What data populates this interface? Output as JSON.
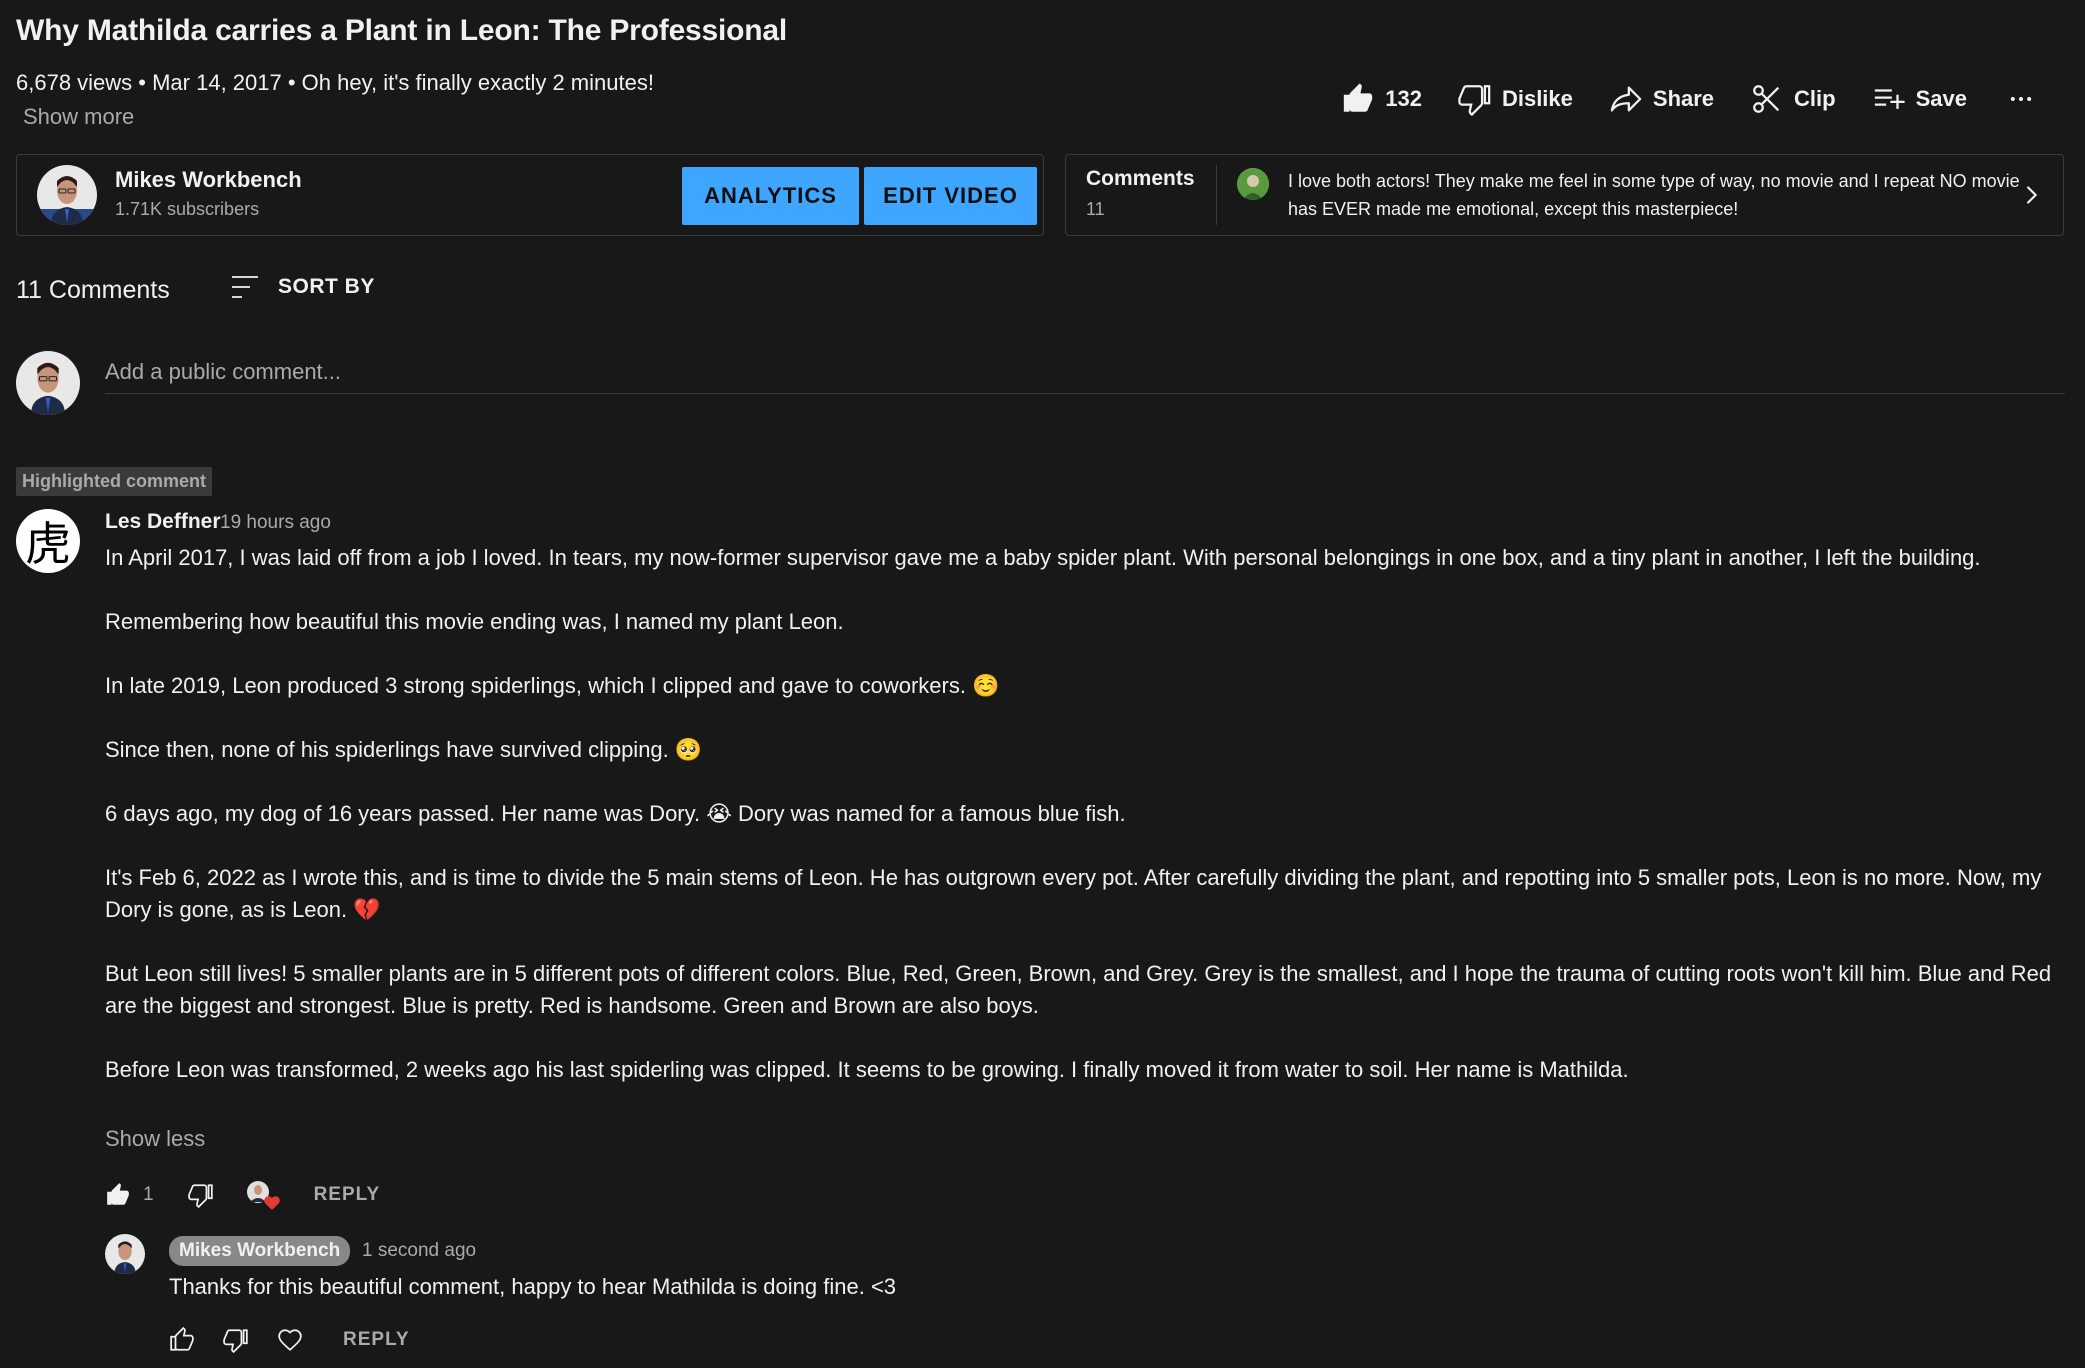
{
  "video": {
    "title": "Why Mathilda carries a Plant in Leon: The Professional",
    "meta": "6,678 views • Mar 14, 2017 • Oh hey, it's finally exactly 2 minutes!",
    "show_more": "Show more"
  },
  "actions": {
    "like_count": "132",
    "dislike": "Dislike",
    "share": "Share",
    "clip": "Clip",
    "save": "Save",
    "more_icon": "more-horiz-icon"
  },
  "channel": {
    "name": "Mikes Workbench",
    "subscribers": "1.71K subscribers",
    "analytics_button": "ANALYTICS",
    "edit_button": "EDIT VIDEO"
  },
  "comments_teaser": {
    "title": "Comments",
    "count": "11",
    "text": "I love both actors! They make me feel in some type of way, no movie and I repeat NO movie has EVER made me emotional, except this masterpiece!"
  },
  "comments_header": {
    "count_label": "11 Comments",
    "sort_label": "SORT BY"
  },
  "add_comment": {
    "placeholder": "Add a public comment..."
  },
  "highlighted": {
    "badge": "Highlighted comment",
    "avatar_glyph": "虎",
    "author": "Les Deffner",
    "time": "19 hours ago",
    "paragraphs": [
      "In April 2017, I was laid off from a job I loved. In tears, my now-former supervisor gave me a baby spider plant. With personal belongings in one box, and a tiny plant in another, I left the building.",
      "Remembering how beautiful this movie ending was, I named my plant Leon.",
      "In late 2019, Leon produced 3 strong spiderlings, which I clipped and gave to coworkers. ☺️",
      "Since then, none of his spiderlings have survived clipping. 🥺",
      "6 days ago, my dog of 16 years passed. Her name was Dory. 😭 Dory was named for a famous blue fish.",
      "It's Feb 6, 2022 as I wrote this, and is time to divide the 5 main stems of Leon. He has outgrown every pot. After carefully dividing the plant, and repotting into 5 smaller pots, Leon is no more. Now, my Dory is gone, as is Leon. 💔",
      "But Leon still lives!  5 smaller plants are in 5 different pots of different colors. Blue, Red, Green, Brown, and Grey.  Grey is the smallest, and I hope the trauma of cutting roots won't kill him. Blue and Red are the biggest and strongest. Blue is pretty. Red is handsome. Green and Brown are also boys.",
      "Before Leon was transformed, 2 weeks ago his last spiderling was clipped. It seems to be growing. I finally moved it from water to soil. Her name is Mathilda."
    ],
    "show_less": "Show less",
    "like_count": "1",
    "reply_label": "REPLY"
  },
  "reply": {
    "author": "Mikes Workbench",
    "time": "1 second ago",
    "text": "Thanks for this beautiful comment, happy to hear Mathilda is doing fine. <3",
    "reply_label": "REPLY"
  },
  "colors": {
    "background": "#181818",
    "accent_blue": "#3ea6ff",
    "heart_red": "#e53935",
    "muted_text": "#aaaaaa"
  }
}
